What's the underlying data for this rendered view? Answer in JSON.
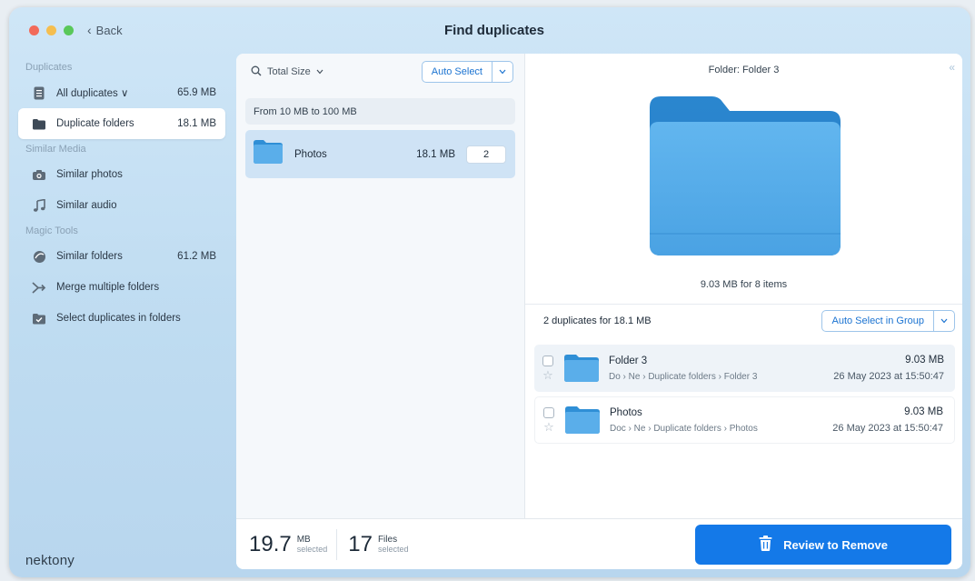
{
  "window": {
    "title": "Find duplicates",
    "back_label": "Back"
  },
  "sidebar": {
    "sections": [
      {
        "label": "Duplicates"
      },
      {
        "label": "Similar Media"
      },
      {
        "label": "Magic Tools"
      }
    ],
    "items": [
      {
        "label": "All duplicates ∨",
        "size": "65.9 MB",
        "icon": "document-icon"
      },
      {
        "label": "Duplicate folders",
        "size": "18.1 MB",
        "icon": "folder-icon",
        "active": true
      },
      {
        "label": "Similar photos",
        "size": "",
        "icon": "camera-icon"
      },
      {
        "label": "Similar audio",
        "size": "",
        "icon": "music-note-icon"
      },
      {
        "label": "Similar folders",
        "size": "61.2 MB",
        "icon": "similar-folders-icon"
      },
      {
        "label": "Merge multiple folders",
        "size": "",
        "icon": "merge-icon"
      },
      {
        "label": "Select duplicates in folders",
        "size": "",
        "icon": "folder-check-icon"
      }
    ],
    "brand": "nektony"
  },
  "list": {
    "sort_label": "Total Size",
    "auto_select_label": "Auto Select",
    "group_header": "From 10 MB to 100 MB",
    "rows": [
      {
        "name": "Photos",
        "size": "18.1 MB",
        "count": "2"
      }
    ]
  },
  "preview": {
    "title": "Folder: Folder 3",
    "info": "9.03 MB for 8 items"
  },
  "duplicates": {
    "header": "2 duplicates for 18.1 MB",
    "auto_select_group_label": "Auto Select in Group",
    "rows": [
      {
        "name": "Folder 3",
        "path": "Do › Ne › Duplicate folders › Folder 3",
        "size": "9.03 MB",
        "date": "26 May 2023 at 15:50:47"
      },
      {
        "name": "Photos",
        "path": "Doc › Ne › Duplicate folders › Photos",
        "size": "9.03 MB",
        "date": "26 May 2023 at 15:50:47"
      }
    ]
  },
  "footer": {
    "size_value": "19.7",
    "size_unit": "MB",
    "size_sub": "selected",
    "files_value": "17",
    "files_unit": "Files",
    "files_sub": "selected",
    "review_label": "Review to Remove"
  },
  "colors": {
    "accent": "#1479e8",
    "folder_blue": "#5aa9e6",
    "selected_row": "#cfe3f5"
  }
}
